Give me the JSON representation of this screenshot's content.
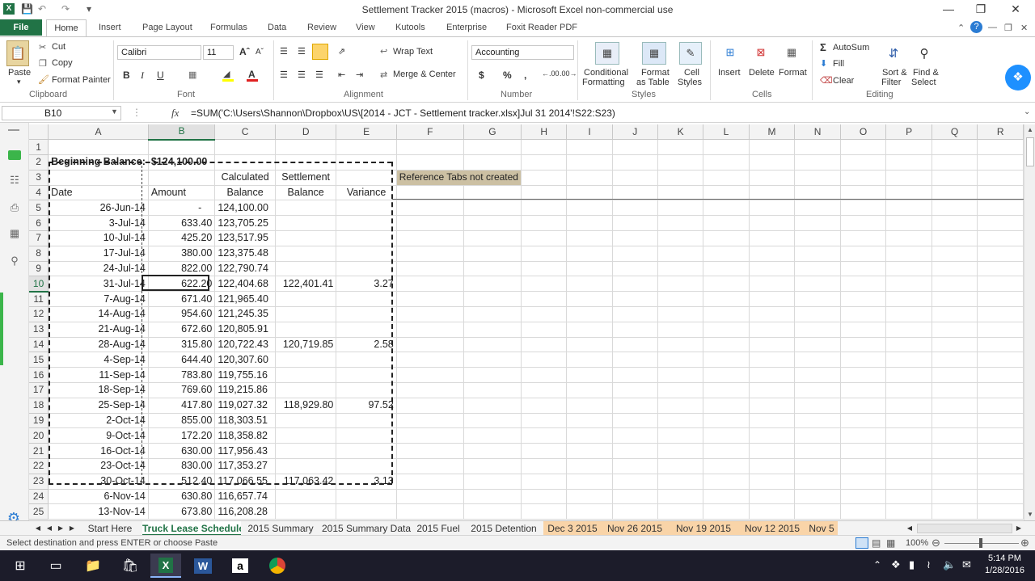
{
  "window": {
    "title": "Settlement Tracker 2015 (macros)  -  Microsoft Excel non-commercial use"
  },
  "ribbon_tabs": {
    "file": "File",
    "home": "Home",
    "others": [
      "Insert",
      "Page Layout",
      "Formulas",
      "Data",
      "Review",
      "View",
      "Kutools",
      "Enterprise",
      "Foxit Reader PDF"
    ]
  },
  "clipboard": {
    "paste": "Paste",
    "cut": "Cut",
    "copy": "Copy",
    "format_painter": "Format Painter",
    "label": "Clipboard"
  },
  "font": {
    "name": "Calibri",
    "size": "11",
    "label": "Font"
  },
  "alignment": {
    "wrap": "Wrap Text",
    "merge": "Merge & Center",
    "label": "Alignment"
  },
  "number": {
    "format": "Accounting",
    "label": "Number"
  },
  "styles": {
    "conditional": [
      "Conditional",
      "Formatting"
    ],
    "table": [
      "Format",
      "as Table"
    ],
    "cell": [
      "Cell",
      "Styles"
    ],
    "label": "Styles"
  },
  "cells": {
    "insert": "Insert",
    "delete": "Delete",
    "format": "Format",
    "label": "Cells"
  },
  "editing": {
    "autosum": "AutoSum",
    "fill": "Fill",
    "clear": "Clear",
    "sort": [
      "Sort &",
      "Filter"
    ],
    "find": [
      "Find &",
      "Select"
    ],
    "label": "Editing"
  },
  "formula_bar": {
    "name_box": "B10",
    "fx": "fx",
    "formula": "=SUM('C:\\Users\\Shannon\\Dropbox\\US\\[2014 - JCT - Settlement tracker.xlsx]Jul 31 2014'!S22:S23)"
  },
  "columns": [
    "A",
    "B",
    "C",
    "D",
    "E",
    "F",
    "G",
    "H",
    "I",
    "J",
    "K",
    "L",
    "M",
    "N",
    "O",
    "P",
    "Q",
    "R"
  ],
  "sheet": {
    "beginning_label": "Beginning Balance:",
    "beginning_value": "$124,100.00",
    "hdr_calc": [
      "Calculated",
      "Balance"
    ],
    "hdr_settle": [
      "Settlement",
      "Balance"
    ],
    "hdr_date": "Date",
    "hdr_amount": "Amount",
    "hdr_variance": "Variance",
    "notice": "Reference Tabs not created",
    "rows": [
      {
        "r": "5",
        "date": "26-Jun-14",
        "amount": "-",
        "calc": "124,100.00",
        "settle": "",
        "var": ""
      },
      {
        "r": "6",
        "date": "3-Jul-14",
        "amount": "633.40",
        "calc": "123,705.25",
        "settle": "",
        "var": ""
      },
      {
        "r": "7",
        "date": "10-Jul-14",
        "amount": "425.20",
        "calc": "123,517.95",
        "settle": "",
        "var": ""
      },
      {
        "r": "8",
        "date": "17-Jul-14",
        "amount": "380.00",
        "calc": "123,375.48",
        "settle": "",
        "var": ""
      },
      {
        "r": "9",
        "date": "24-Jul-14",
        "amount": "822.00",
        "calc": "122,790.74",
        "settle": "",
        "var": ""
      },
      {
        "r": "10",
        "date": "31-Jul-14",
        "amount": "622.20",
        "calc": "122,404.68",
        "settle": "122,401.41",
        "var": "3.27"
      },
      {
        "r": "11",
        "date": "7-Aug-14",
        "amount": "671.40",
        "calc": "121,965.40",
        "settle": "",
        "var": ""
      },
      {
        "r": "12",
        "date": "14-Aug-14",
        "amount": "954.60",
        "calc": "121,245.35",
        "settle": "",
        "var": ""
      },
      {
        "r": "13",
        "date": "21-Aug-14",
        "amount": "672.60",
        "calc": "120,805.91",
        "settle": "",
        "var": ""
      },
      {
        "r": "14",
        "date": "28-Aug-14",
        "amount": "315.80",
        "calc": "120,722.43",
        "settle": "120,719.85",
        "var": "2.58"
      },
      {
        "r": "15",
        "date": "4-Sep-14",
        "amount": "644.40",
        "calc": "120,307.60",
        "settle": "",
        "var": ""
      },
      {
        "r": "16",
        "date": "11-Sep-14",
        "amount": "783.80",
        "calc": "119,755.16",
        "settle": "",
        "var": ""
      },
      {
        "r": "17",
        "date": "18-Sep-14",
        "amount": "769.60",
        "calc": "119,215.86",
        "settle": "",
        "var": ""
      },
      {
        "r": "18",
        "date": "25-Sep-14",
        "amount": "417.80",
        "calc": "119,027.32",
        "settle": "118,929.80",
        "var": "97.52"
      },
      {
        "r": "19",
        "date": "2-Oct-14",
        "amount": "855.00",
        "calc": "118,303.51",
        "settle": "",
        "var": ""
      },
      {
        "r": "20",
        "date": "9-Oct-14",
        "amount": "172.20",
        "calc": "118,358.82",
        "settle": "",
        "var": ""
      },
      {
        "r": "21",
        "date": "16-Oct-14",
        "amount": "630.00",
        "calc": "117,956.43",
        "settle": "",
        "var": ""
      },
      {
        "r": "22",
        "date": "23-Oct-14",
        "amount": "830.00",
        "calc": "117,353.27",
        "settle": "",
        "var": ""
      },
      {
        "r": "23",
        "date": "30-Oct-14",
        "amount": "512.40",
        "calc": "117,066.55",
        "settle": "117,063.42",
        "var": "3.13"
      },
      {
        "r": "24",
        "date": "6-Nov-14",
        "amount": "630.80",
        "calc": "116,657.74",
        "settle": "",
        "var": ""
      },
      {
        "r": "25",
        "date": "13-Nov-14",
        "amount": "673.80",
        "calc": "116,208.28",
        "settle": "",
        "var": ""
      }
    ]
  },
  "sheet_tabs": [
    "Start Here",
    "Truck Lease Schedule",
    "2015 Summary",
    "2015 Summary Data",
    "2015 Fuel",
    "2015 Detention",
    "Dec 3 2015",
    "Nov 26 2015",
    "Nov 19 2015",
    "Nov 12 2015",
    "Nov 5"
  ],
  "active_sheet": "Truck Lease Schedule",
  "status": {
    "message": "Select destination and press ENTER or choose Paste",
    "zoom": "100%"
  },
  "taskbar": {
    "time": "5:14 PM",
    "date": "1/28/2016"
  },
  "colors": {
    "accent": "#217346",
    "notice_bg": "#ccc0a3"
  }
}
